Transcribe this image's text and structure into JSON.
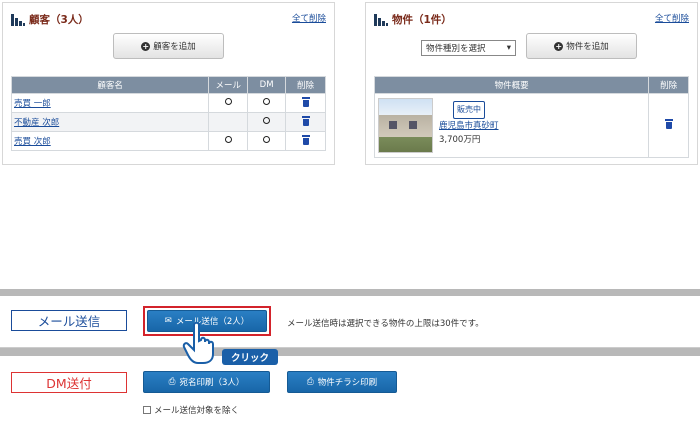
{
  "customers": {
    "title": "顧客（3人）",
    "delete_all": "全て削除",
    "add_button": "顧客を追加",
    "columns": [
      "顧客名",
      "メール",
      "DM",
      "削除"
    ],
    "rows": [
      {
        "name": "売買 一郎",
        "mail": true,
        "dm": true
      },
      {
        "name": "不動産 次郎",
        "mail": false,
        "dm": true
      },
      {
        "name": "売買 次郎",
        "mail": true,
        "dm": true
      }
    ]
  },
  "properties": {
    "title": "物件（1件）",
    "delete_all": "全て削除",
    "type_select": "物件種別を選択",
    "add_button": "物件を追加",
    "columns": [
      "物件概要",
      "削除"
    ],
    "rows": [
      {
        "status": "販売中",
        "address": "鹿児島市真砂町",
        "price": "3,700万円"
      }
    ]
  },
  "mail_section": {
    "label": "メール送信",
    "send_button": "メール送信（2人）",
    "note": "メール送信時は選択できる物件の上限は30件です。"
  },
  "dm_section": {
    "label": "DM送付",
    "address_print_button": "宛名印刷（3人）",
    "flyer_print_button": "物件チラシ印刷",
    "exclude_mail_checkbox": "メール送信対象を除く"
  },
  "callout": {
    "click_label": "クリック"
  },
  "colors": {
    "header_bg": "#7d8ea1",
    "primary": "#1866a8",
    "highlight": "#d3232b",
    "link": "#1a4c9a"
  }
}
